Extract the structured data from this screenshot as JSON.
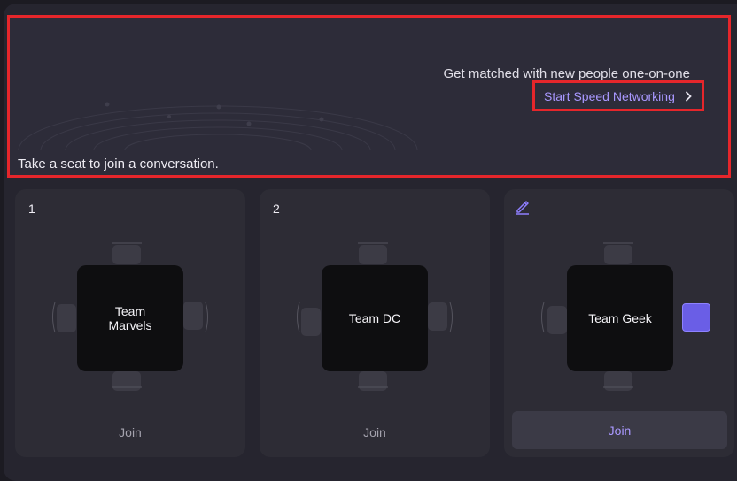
{
  "banner": {
    "title": "Get matched with new people one-on-one",
    "speed_networking_label": "Start Speed Networking",
    "hint": "Take a seat to join a conversation."
  },
  "tables": [
    {
      "number": "1",
      "name": "Team Marvels",
      "join_label": "Join"
    },
    {
      "number": "2",
      "name": "Team DC",
      "join_label": "Join"
    },
    {
      "number": "",
      "name": "Team Geek",
      "join_label": "Join"
    }
  ],
  "icons": {
    "edit": "pencil-icon",
    "chevron": "chevron-right-icon"
  },
  "colors": {
    "accent": "#a998ff",
    "highlight_border": "#e5262b",
    "occupied_seat": "#6a5ee6"
  }
}
